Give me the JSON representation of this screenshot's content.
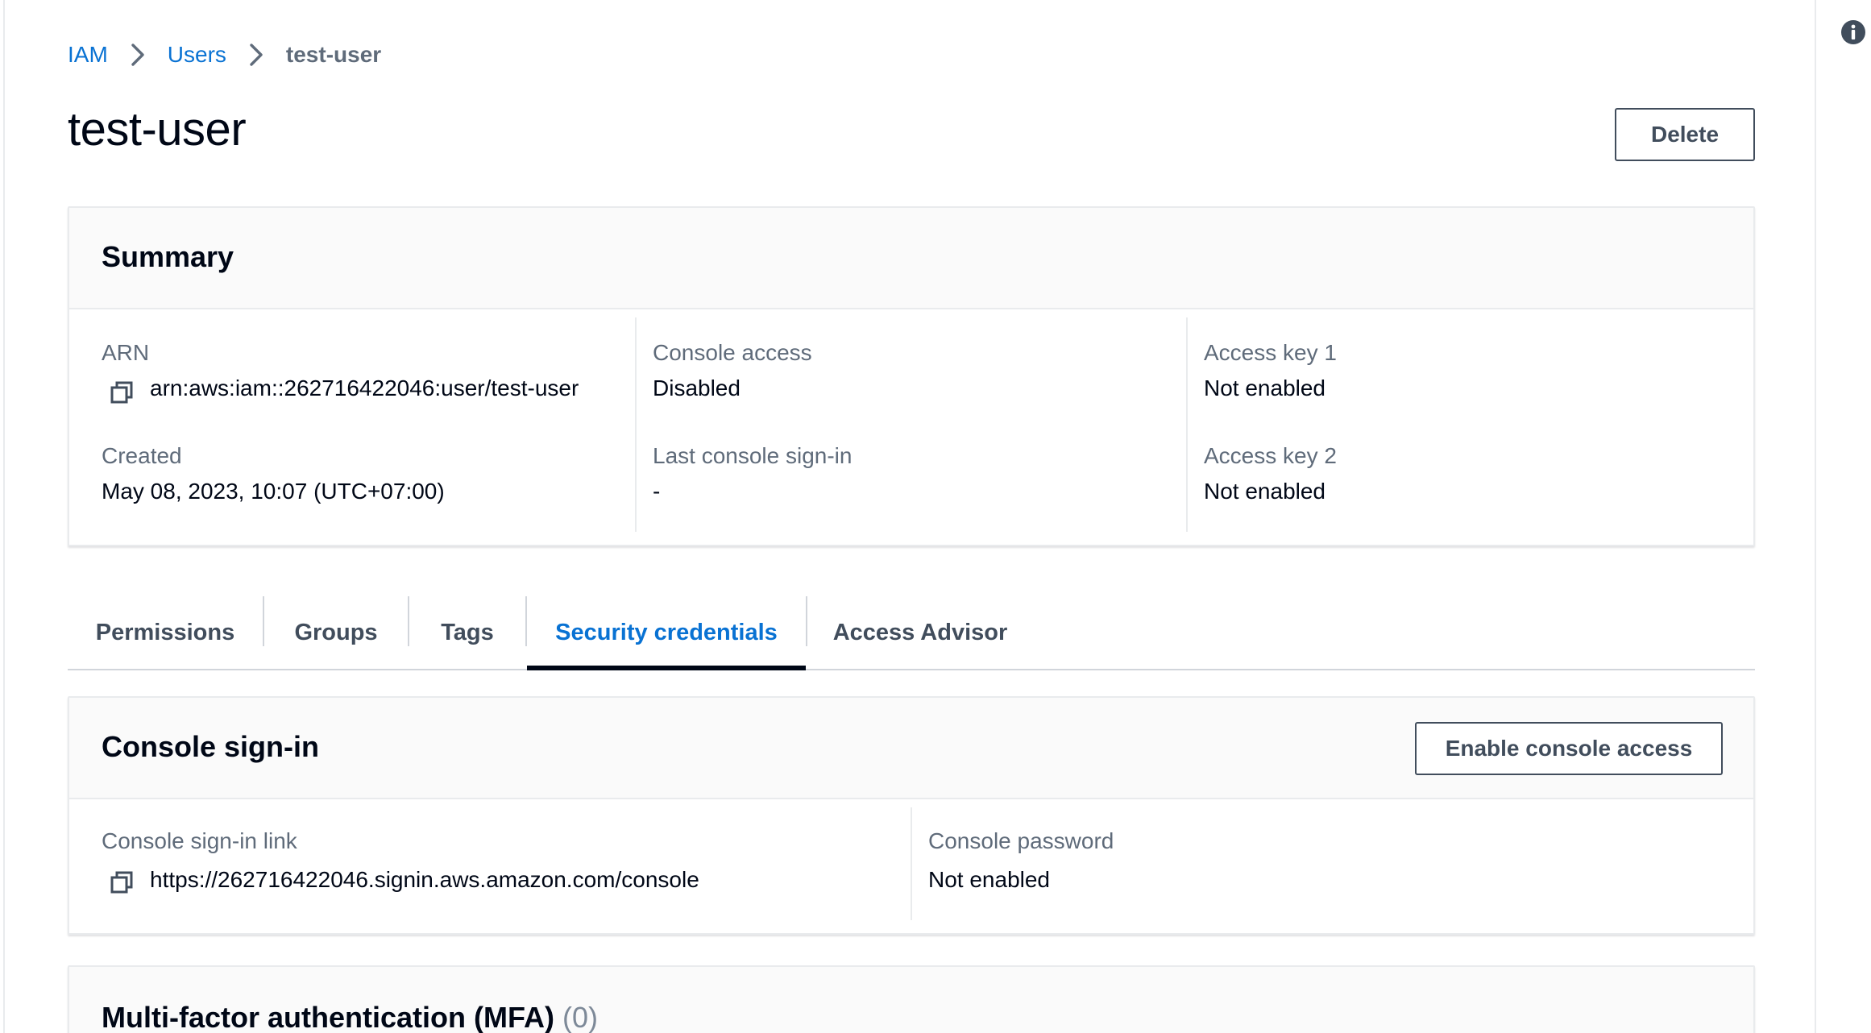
{
  "breadcrumb": {
    "iam": "IAM",
    "users": "Users",
    "current": "test-user"
  },
  "page": {
    "title": "test-user",
    "delete_label": "Delete"
  },
  "summary": {
    "title": "Summary",
    "arn_label": "ARN",
    "arn_value": "arn:aws:iam::262716422046:user/test-user",
    "created_label": "Created",
    "created_value": "May 08, 2023, 10:07 (UTC+07:00)",
    "console_access_label": "Console access",
    "console_access_value": "Disabled",
    "last_signin_label": "Last console sign-in",
    "last_signin_value": "-",
    "access_key1_label": "Access key 1",
    "access_key1_value": "Not enabled",
    "access_key2_label": "Access key 2",
    "access_key2_value": "Not enabled"
  },
  "tabs": [
    {
      "label": "Permissions",
      "active": false
    },
    {
      "label": "Groups",
      "active": false
    },
    {
      "label": "Tags",
      "active": false
    },
    {
      "label": "Security credentials",
      "active": true
    },
    {
      "label": "Access Advisor",
      "active": false
    }
  ],
  "console_signin": {
    "title": "Console sign-in",
    "enable_label": "Enable console access",
    "link_label": "Console sign-in link",
    "link_value": "https://262716422046.signin.aws.amazon.com/console",
    "password_label": "Console password",
    "password_value": "Not enabled"
  },
  "mfa": {
    "title": "Multi-factor authentication (MFA)",
    "count": "(0)"
  },
  "colors": {
    "link": "#0972d3",
    "text": "#000716",
    "muted": "#5f6b7a",
    "border": "#e9ebed",
    "header_bg": "#fafafa"
  },
  "icons": {
    "breadcrumb_separator": "chevron-right-icon",
    "copy": "copy-icon",
    "info": "info-icon"
  }
}
